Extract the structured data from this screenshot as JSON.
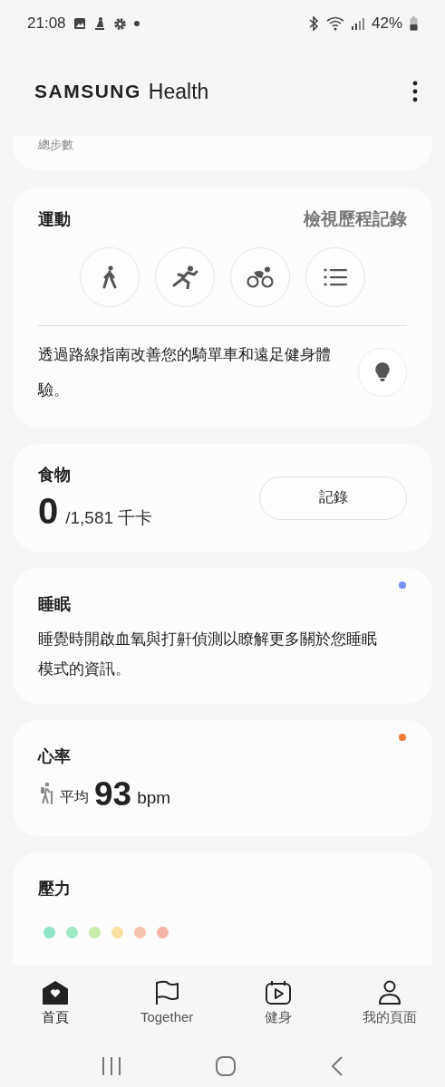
{
  "status_bar": {
    "time": "21:08",
    "battery": "42%"
  },
  "app_bar": {
    "brand": "SAMSUNG",
    "title": "Health"
  },
  "steps_card": {
    "label": "總步數"
  },
  "exercise": {
    "title": "運動",
    "link": "檢視歷程記錄",
    "shortcuts": [
      {
        "kind": "walk"
      },
      {
        "kind": "run"
      },
      {
        "kind": "bike"
      },
      {
        "kind": "list"
      }
    ],
    "tip": "透過路線指南改善您的騎單車和遠足健身體驗。"
  },
  "food": {
    "title": "食物",
    "value": "0",
    "target": "/1,581 千卡",
    "button": "記錄"
  },
  "sleep": {
    "title": "睡眠",
    "text": "睡覺時開啟血氧與打鼾偵測以瞭解更多關於您睡眠模式的資訊。",
    "color": "#7b8ff0"
  },
  "heart_rate": {
    "title": "心率",
    "label": "平均",
    "value": "93",
    "unit": "bpm",
    "color": "#f07a3c"
  },
  "stress": {
    "title": "壓力",
    "levels": [
      {
        "color": "#8fe3c8"
      },
      {
        "color": "#9be8c2"
      },
      {
        "color": "#c8ecaa"
      },
      {
        "color": "#f7e0a0"
      },
      {
        "color": "#f5c2aa"
      },
      {
        "color": "#f2b3a6"
      }
    ]
  },
  "bottom_nav": [
    {
      "label": "首頁",
      "kind": "home",
      "selected": true
    },
    {
      "label": "Together",
      "kind": "flag",
      "selected": false
    },
    {
      "label": "健身",
      "kind": "fitness",
      "selected": false
    },
    {
      "label": "我的頁面",
      "kind": "person",
      "selected": false
    }
  ]
}
